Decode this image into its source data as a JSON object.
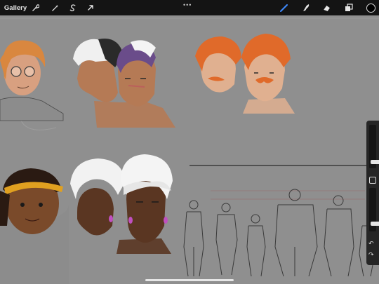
{
  "toolbar": {
    "gallery_label": "Gallery",
    "more_indicator": "•••",
    "tools": [
      {
        "name": "actions",
        "icon": "wrench-icon"
      },
      {
        "name": "adjustments",
        "icon": "magic-wand-icon"
      },
      {
        "name": "selection",
        "icon": "selection-s-icon"
      },
      {
        "name": "transform",
        "icon": "arrow-cursor-icon"
      },
      {
        "name": "brush",
        "icon": "brush-icon",
        "active": true,
        "color": "#3f8bff"
      },
      {
        "name": "smudge",
        "icon": "smudge-finger-icon"
      },
      {
        "name": "eraser",
        "icon": "eraser-icon"
      },
      {
        "name": "layers",
        "icon": "layers-icon"
      }
    ],
    "current_color": "#000000"
  },
  "sidebar": {
    "brush_size_level": 0.1,
    "opacity_level": 0.15,
    "undo_icon": "undo-arrow-icon",
    "redo_icon": "redo-arrow-icon"
  },
  "colors": {
    "toolbar_bg": "#141414",
    "canvas_bg": "#8f8f8f",
    "accent_blue": "#3f8bff"
  }
}
